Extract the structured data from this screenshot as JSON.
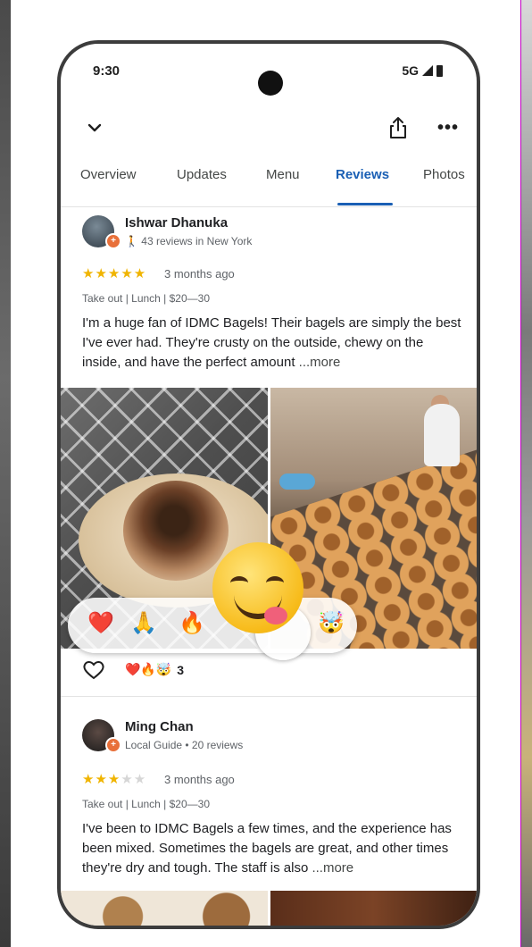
{
  "status_bar": {
    "time": "9:30",
    "network": "5G"
  },
  "tabs": [
    {
      "label": "Overview"
    },
    {
      "label": "Updates"
    },
    {
      "label": "Menu"
    },
    {
      "label": "Reviews"
    },
    {
      "label": "Photos"
    }
  ],
  "active_tab": "Reviews",
  "reviews": [
    {
      "name": "Ishwar Dhanuka",
      "meta": "43 reviews in New York",
      "rating": 5,
      "stars_on": "★★★★★",
      "stars_off": "",
      "when": "3 months ago",
      "tags": "Take out | Lunch | $20—30",
      "text": "I'm a huge fan of IDMC Bagels! Their bagels are simply the best I've ever had. They're crusty on the outside, chewy on the inside, and have the perfect amount ",
      "more": "...more",
      "reaction_options": [
        "❤️",
        "🙏",
        "🔥",
        "😋",
        "🤯"
      ],
      "reaction_summary": "❤️🔥🤯",
      "reaction_count": "3"
    },
    {
      "name": "Ming Chan",
      "meta": "Local Guide • 20 reviews",
      "rating": 3,
      "stars_on": "★★★",
      "stars_off": "★★",
      "when": "3 months ago",
      "tags": "Take out | Lunch | $20—30",
      "text": "I've been to IDMC Bagels a few times, and the experience has been mixed. Sometimes the bagels are great, and other times they're dry and tough. The staff is also ",
      "more": "...more"
    }
  ],
  "colors": {
    "accent": "#1a5fb4",
    "star": "#f0b400",
    "badge": "#e8703a"
  },
  "icons": [
    "chevron-down-icon",
    "share-icon",
    "more-options-icon",
    "heart-outline-icon",
    "walking-icon"
  ]
}
